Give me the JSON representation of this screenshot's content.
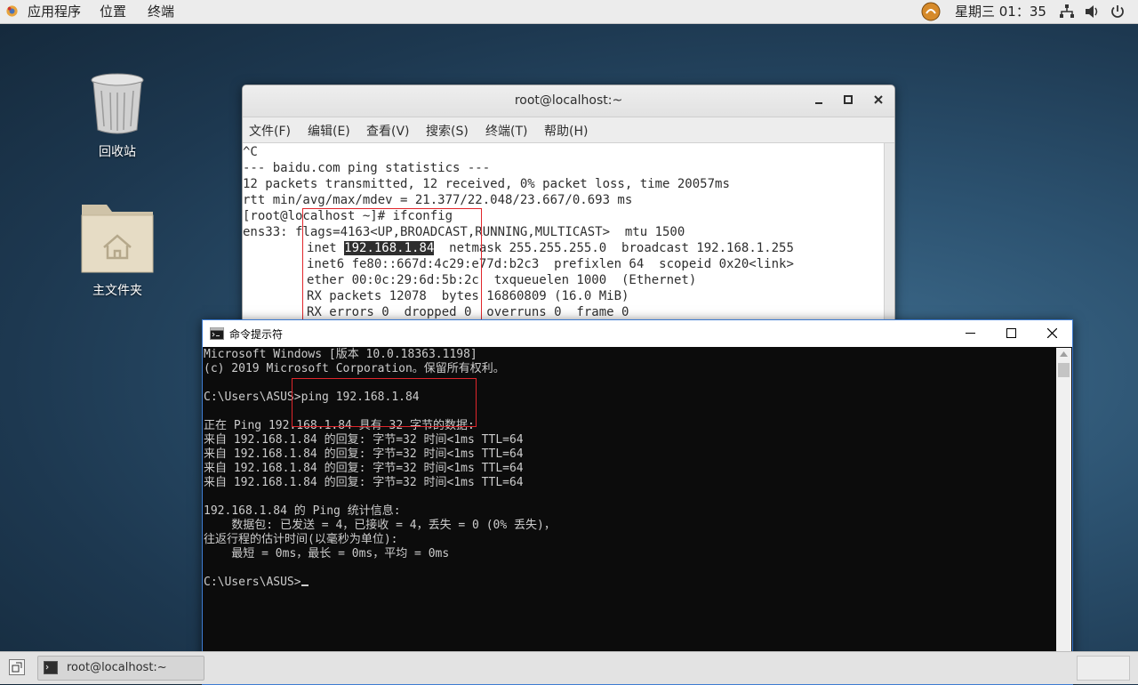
{
  "topbar": {
    "menus": [
      "应用程序",
      "位置",
      "终端"
    ],
    "clock": "星期三 01：35"
  },
  "desktop": {
    "icons": [
      {
        "label": "回收站"
      },
      {
        "label": "主文件夹"
      }
    ]
  },
  "linux_terminal": {
    "title": "root@localhost:~",
    "menu": [
      "文件(F)",
      "编辑(E)",
      "查看(V)",
      "搜索(S)",
      "终端(T)",
      "帮助(H)"
    ],
    "lines": [
      "^C",
      "--- baidu.com ping statistics ---",
      "12 packets transmitted, 12 received, 0% packet loss, time 20057ms",
      "rtt min/avg/max/mdev = 21.377/22.048/23.667/0.693 ms",
      "[root@localhost ~]# ifconfig",
      "ens33: flags=4163<UP,BROADCAST,RUNNING,MULTICAST>  mtu 1500",
      "inet ",
      "inet6 fe80::667d:4c29:e77d:b2c3  prefixlen 64  scopeid 0x20<link>",
      "ether 00:0c:29:6d:5b:2c  txqueuelen 1000  (Ethernet)",
      "RX packets 12078  bytes 16860809 (16.0 MiB)",
      "RX errors 0  dropped 0  overruns 0  frame 0"
    ],
    "ip_selected": "192.168.1.84",
    "inet_rest": "  netmask 255.255.255.0  broadcast 192.168.1.255"
  },
  "cmd": {
    "title": "命令提示符",
    "lines": [
      "Microsoft Windows [版本 10.0.18363.1198]",
      "(c) 2019 Microsoft Corporation。保留所有权利。",
      "",
      "C:\\Users\\ASUS>ping 192.168.1.84",
      "",
      "正在 Ping 192.168.1.84 具有 32 字节的数据:",
      "来自 192.168.1.84 的回复: 字节=32 时间<1ms TTL=64",
      "来自 192.168.1.84 的回复: 字节=32 时间<1ms TTL=64",
      "来自 192.168.1.84 的回复: 字节=32 时间<1ms TTL=64",
      "来自 192.168.1.84 的回复: 字节=32 时间<1ms TTL=64",
      "",
      "192.168.1.84 的 Ping 统计信息:",
      "    数据包: 已发送 = 4，已接收 = 4，丢失 = 0 (0% 丢失)，",
      "往返行程的估计时间(以毫秒为单位):",
      "    最短 = 0ms，最长 = 0ms，平均 = 0ms",
      "",
      "C:\\Users\\ASUS>"
    ]
  },
  "taskbar": {
    "task_label": "root@localhost:~"
  },
  "colors": {
    "highlight_box": "#e0262b",
    "desktop_bg": "#2c5270"
  }
}
